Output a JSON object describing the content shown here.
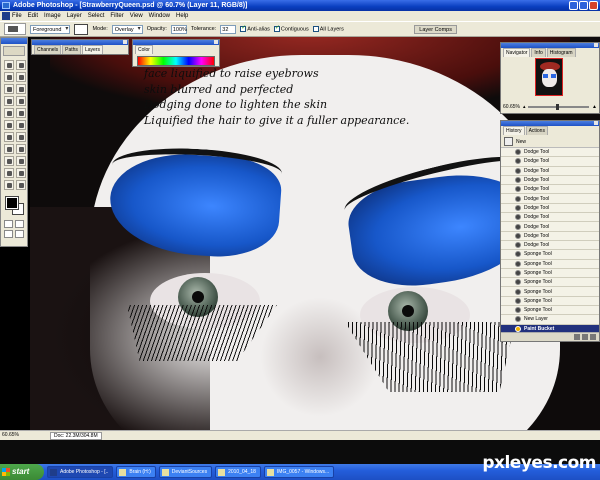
{
  "window": {
    "title": "Adobe Photoshop - [StrawberryQueen.psd @ 60.7% (Layer 11, RGB/8)]"
  },
  "menu": [
    "File",
    "Edit",
    "Image",
    "Layer",
    "Select",
    "Filter",
    "View",
    "Window",
    "Help"
  ],
  "options": {
    "foreground_value": "Foreground",
    "mode_label": "Mode:",
    "mode_value": "Overlay",
    "opacity_label": "Opacity:",
    "opacity_value": "100%",
    "tolerance_label": "Tolerance:",
    "tolerance_value": "32",
    "anti_alias_label": "Anti-alias",
    "contiguous_label": "Contiguous",
    "all_layers_label": "All Layers",
    "layer_comps_tab": "Layer Comps"
  },
  "layers_panel": {
    "tabs": [
      "Channels",
      "Paths",
      "Layers"
    ]
  },
  "color_panel": {
    "tabs": [
      "Color"
    ]
  },
  "navigator": {
    "tabs": [
      "Navigator",
      "Info",
      "Histogram"
    ],
    "zoom": "60.65%"
  },
  "history": {
    "tabs": [
      "History",
      "Actions"
    ],
    "snapshot_label": "New",
    "items": [
      "Dodge Tool",
      "Dodge Tool",
      "Dodge Tool",
      "Dodge Tool",
      "Dodge Tool",
      "Dodge Tool",
      "Dodge Tool",
      "Dodge Tool",
      "Dodge Tool",
      "Dodge Tool",
      "Dodge Tool",
      "Sponge Tool",
      "Sponge Tool",
      "Sponge Tool",
      "Sponge Tool",
      "Sponge Tool",
      "Sponge Tool",
      "Sponge Tool",
      "New Layer",
      "Paint Bucket"
    ],
    "selected_index": 19
  },
  "canvas_text": [
    "face liquified to raise eyebrows",
    "skin blurred and perfected",
    "Dodging done to lighten the skin",
    "Liquified the hair to give it a fuller appearance."
  ],
  "status": {
    "zoom": "60.65%",
    "doc": "Doc: 22.3M/304.8M"
  },
  "taskbar": {
    "start": "start",
    "items": [
      "Adobe Photoshop - [..",
      "Brain (H:)",
      "DeviantSources",
      "2010_04_18",
      "IMG_0057 - Windows..."
    ]
  },
  "watermark": "pxleyes.com",
  "colors": {
    "title_bar": "#0a3fc0",
    "chrome": "#ece9d8",
    "taskbar": "#245edb",
    "start": "#3b8a35",
    "eyeshadow": "#1757c9",
    "history_selected": "#22317d"
  }
}
